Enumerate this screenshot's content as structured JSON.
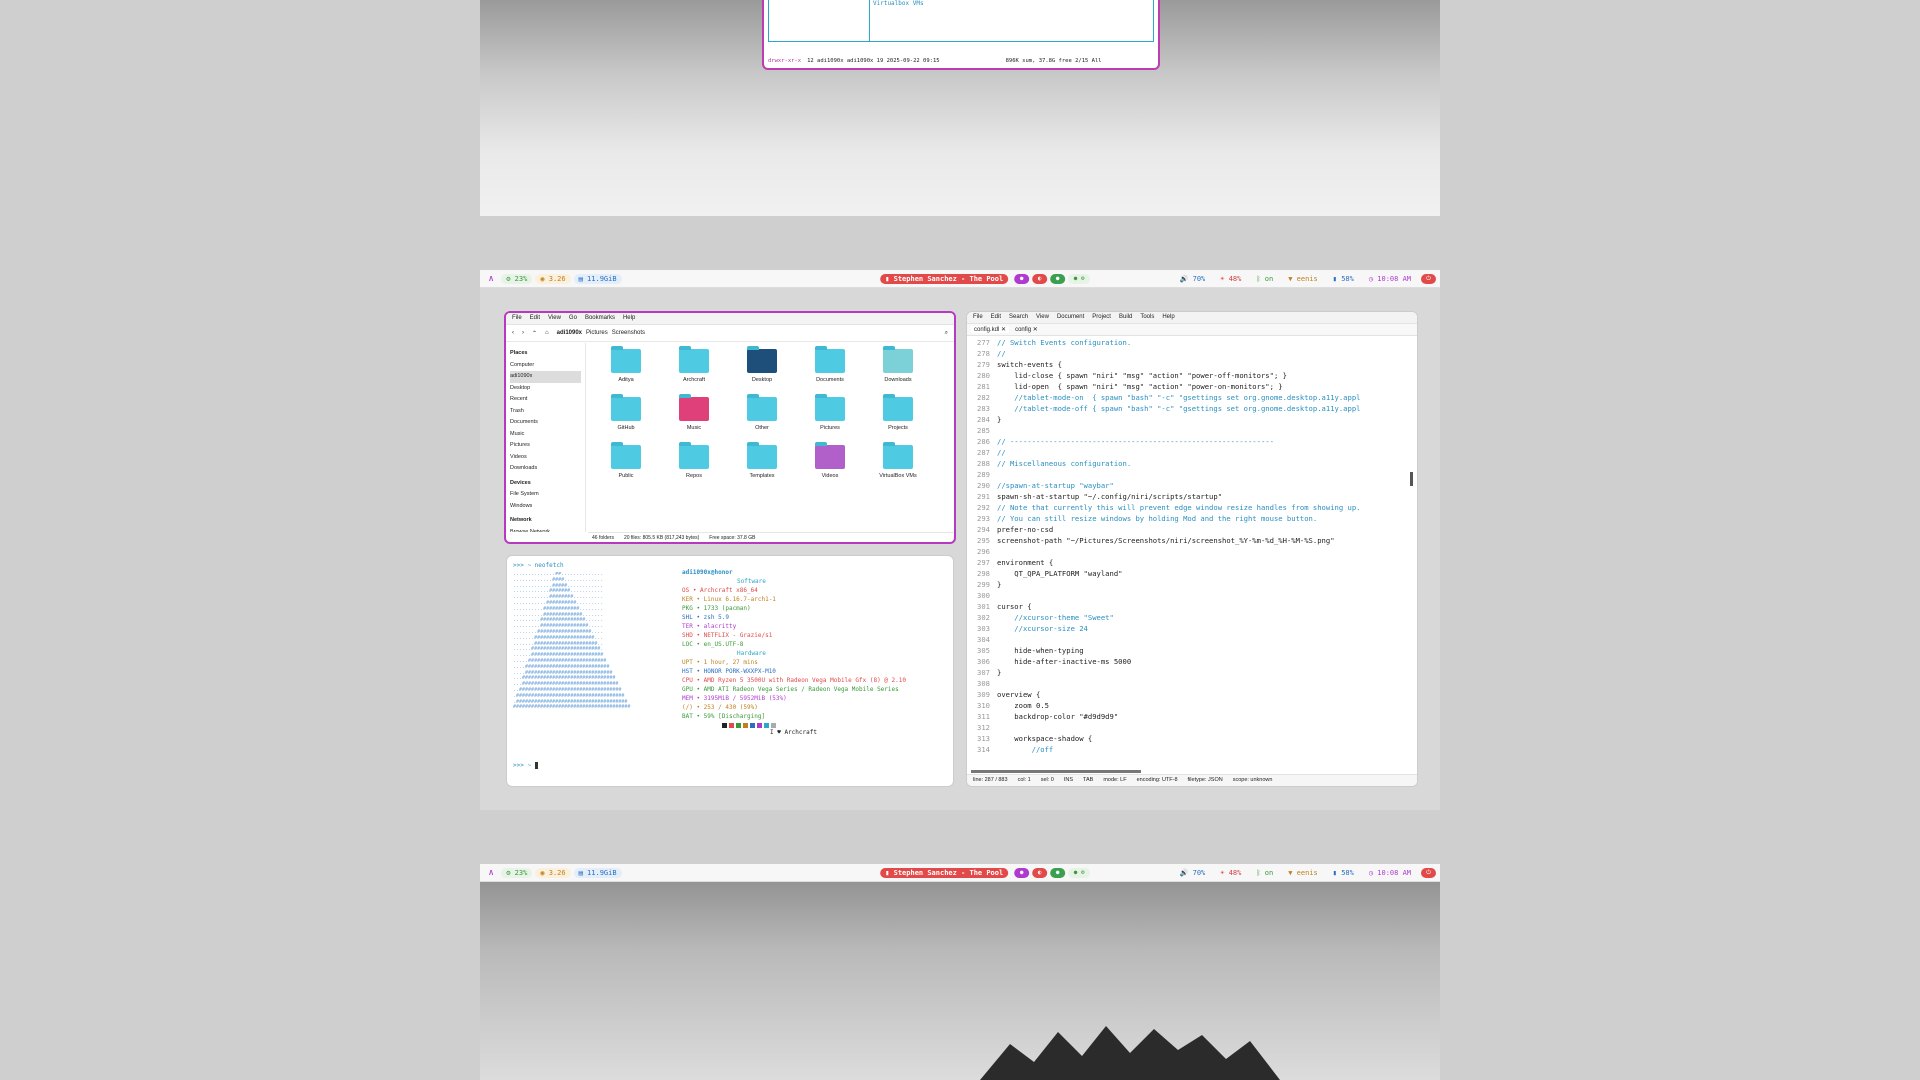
{
  "top_win": {
    "tree_item": "Virtualbox VMs",
    "status_perm": "drwxr-xr-x",
    "status_meta": "12 adi1090x adi1090x 19 2025-09-22 09:15",
    "status_right": "896K sum, 37.8G free  2/15  All"
  },
  "waybar": {
    "cpu": "23%",
    "load": "3.26",
    "mem": "11.9GiB",
    "media": "Stephen Sanchez - The Pool",
    "volume": "70%",
    "brightness": "48%",
    "bt": "on",
    "wifi": "eenis",
    "battery": "58%",
    "time": "10:08 AM"
  },
  "fm": {
    "menu": [
      "File",
      "Edit",
      "View",
      "Go",
      "Bookmarks",
      "Help"
    ],
    "path": [
      "adi1090x",
      "Pictures",
      "Screenshots"
    ],
    "places_header": "Places",
    "places": [
      "Computer",
      "adi1090x",
      "Desktop",
      "Recent",
      "Trash",
      "Documents",
      "Music",
      "Pictures",
      "Videos",
      "Downloads"
    ],
    "devices_header": "Devices",
    "devices": [
      "File System",
      "Windows"
    ],
    "network_header": "Network",
    "network": [
      "Browse Network"
    ],
    "folders": [
      "Aditya",
      "Archcraft",
      "Desktop",
      "Documents",
      "Downloads",
      "GitHub",
      "Music",
      "Other",
      "Pictures",
      "Projects",
      "Public",
      "Repos",
      "Templates",
      "Videos",
      "VirtualBox VMs"
    ],
    "status": [
      "46 folders",
      "20 files: 805.5 KB (817,243 bytes)",
      "Free space: 37.8 GB"
    ]
  },
  "term": {
    "prompt": ">>> ~ neofetch",
    "user": "adi1090x@honor",
    "software_header": "Software",
    "software": [
      "OS  • Archcraft x86_64",
      "KER • Linux 6.16.7-arch1-1",
      "PKG • 1733 (pacman)",
      "SHL • zsh 5.9",
      "TER • alacritty",
      "SHD • NETFLIX - Grazie/s1",
      "LOC • en_US.UTF-8"
    ],
    "hardware_header": "Hardware",
    "hardware": [
      "UPT • 1 hour, 27 mins",
      "HST • HONOR PORK-WXXPX-M10",
      "CPU • AMD Ryzen 5 3500U with Radeon Vega Mobile Gfx (8) @ 2.10",
      "GPU • AMD ATI Radeon Vega Series / Radeon Vega Mobile Series",
      "MEM • 3195MiB / 5952MiB (53%)",
      "(/) • 253 / 430 (59%)",
      "BAT • 59% [Discharging]"
    ],
    "footer": "I ♥ Archcraft",
    "prompt2": ">>> ~"
  },
  "editor": {
    "menu": [
      "File",
      "Edit",
      "Search",
      "View",
      "Document",
      "Project",
      "Build",
      "Tools",
      "Help"
    ],
    "tabs": [
      "config.kdl",
      "config"
    ],
    "lines": [
      [
        "277",
        "// Switch Events configuration."
      ],
      [
        "278",
        "//"
      ],
      [
        "279",
        "switch-events {"
      ],
      [
        "280",
        "    lid-close { spawn \"niri\" \"msg\" \"action\" \"power-off-monitors\"; }"
      ],
      [
        "281",
        "    lid-open  { spawn \"niri\" \"msg\" \"action\" \"power-on-monitors\"; }"
      ],
      [
        "282",
        "    //tablet-mode-on  { spawn \"bash\" \"-c\" \"gsettings set org.gnome.desktop.a11y.appl"
      ],
      [
        "283",
        "    //tablet-mode-off { spawn \"bash\" \"-c\" \"gsettings set org.gnome.desktop.a11y.appl"
      ],
      [
        "284",
        "}"
      ],
      [
        "285",
        ""
      ],
      [
        "286",
        "// -------------------------------------------------------------"
      ],
      [
        "287",
        "//"
      ],
      [
        "288",
        "// Miscellaneous configuration."
      ],
      [
        "289",
        ""
      ],
      [
        "290",
        "//spawn-at-startup \"waybar\""
      ],
      [
        "291",
        "spawn-sh-at-startup \"~/.config/niri/scripts/startup\""
      ],
      [
        "292",
        "// Note that currently this will prevent edge window resize handles from showing up."
      ],
      [
        "293",
        "// You can still resize windows by holding Mod and the right mouse button."
      ],
      [
        "294",
        "prefer-no-csd"
      ],
      [
        "295",
        "screenshot-path \"~/Pictures/Screenshots/niri/screenshot_%Y-%m-%d_%H-%M-%S.png\""
      ],
      [
        "296",
        ""
      ],
      [
        "297",
        "environment {"
      ],
      [
        "298",
        "    QT_QPA_PLATFORM \"wayland\""
      ],
      [
        "299",
        "}"
      ],
      [
        "300",
        ""
      ],
      [
        "301",
        "cursor {"
      ],
      [
        "302",
        "    //xcursor-theme \"Sweet\""
      ],
      [
        "303",
        "    //xcursor-size 24"
      ],
      [
        "304",
        ""
      ],
      [
        "305",
        "    hide-when-typing"
      ],
      [
        "306",
        "    hide-after-inactive-ms 5000"
      ],
      [
        "307",
        "}"
      ],
      [
        "308",
        ""
      ],
      [
        "309",
        "overview {"
      ],
      [
        "310",
        "    zoom 0.5"
      ],
      [
        "311",
        "    backdrop-color \"#d9d9d9\""
      ],
      [
        "312",
        ""
      ],
      [
        "313",
        "    workspace-shadow {"
      ],
      [
        "314",
        "        //off"
      ]
    ],
    "status": [
      "line: 287 / 883",
      "col: 1",
      "sel: 0",
      "INS",
      "TAB",
      "mode: LF",
      "encoding: UTF-8",
      "filetype: JSON",
      "scope: unknown"
    ]
  }
}
